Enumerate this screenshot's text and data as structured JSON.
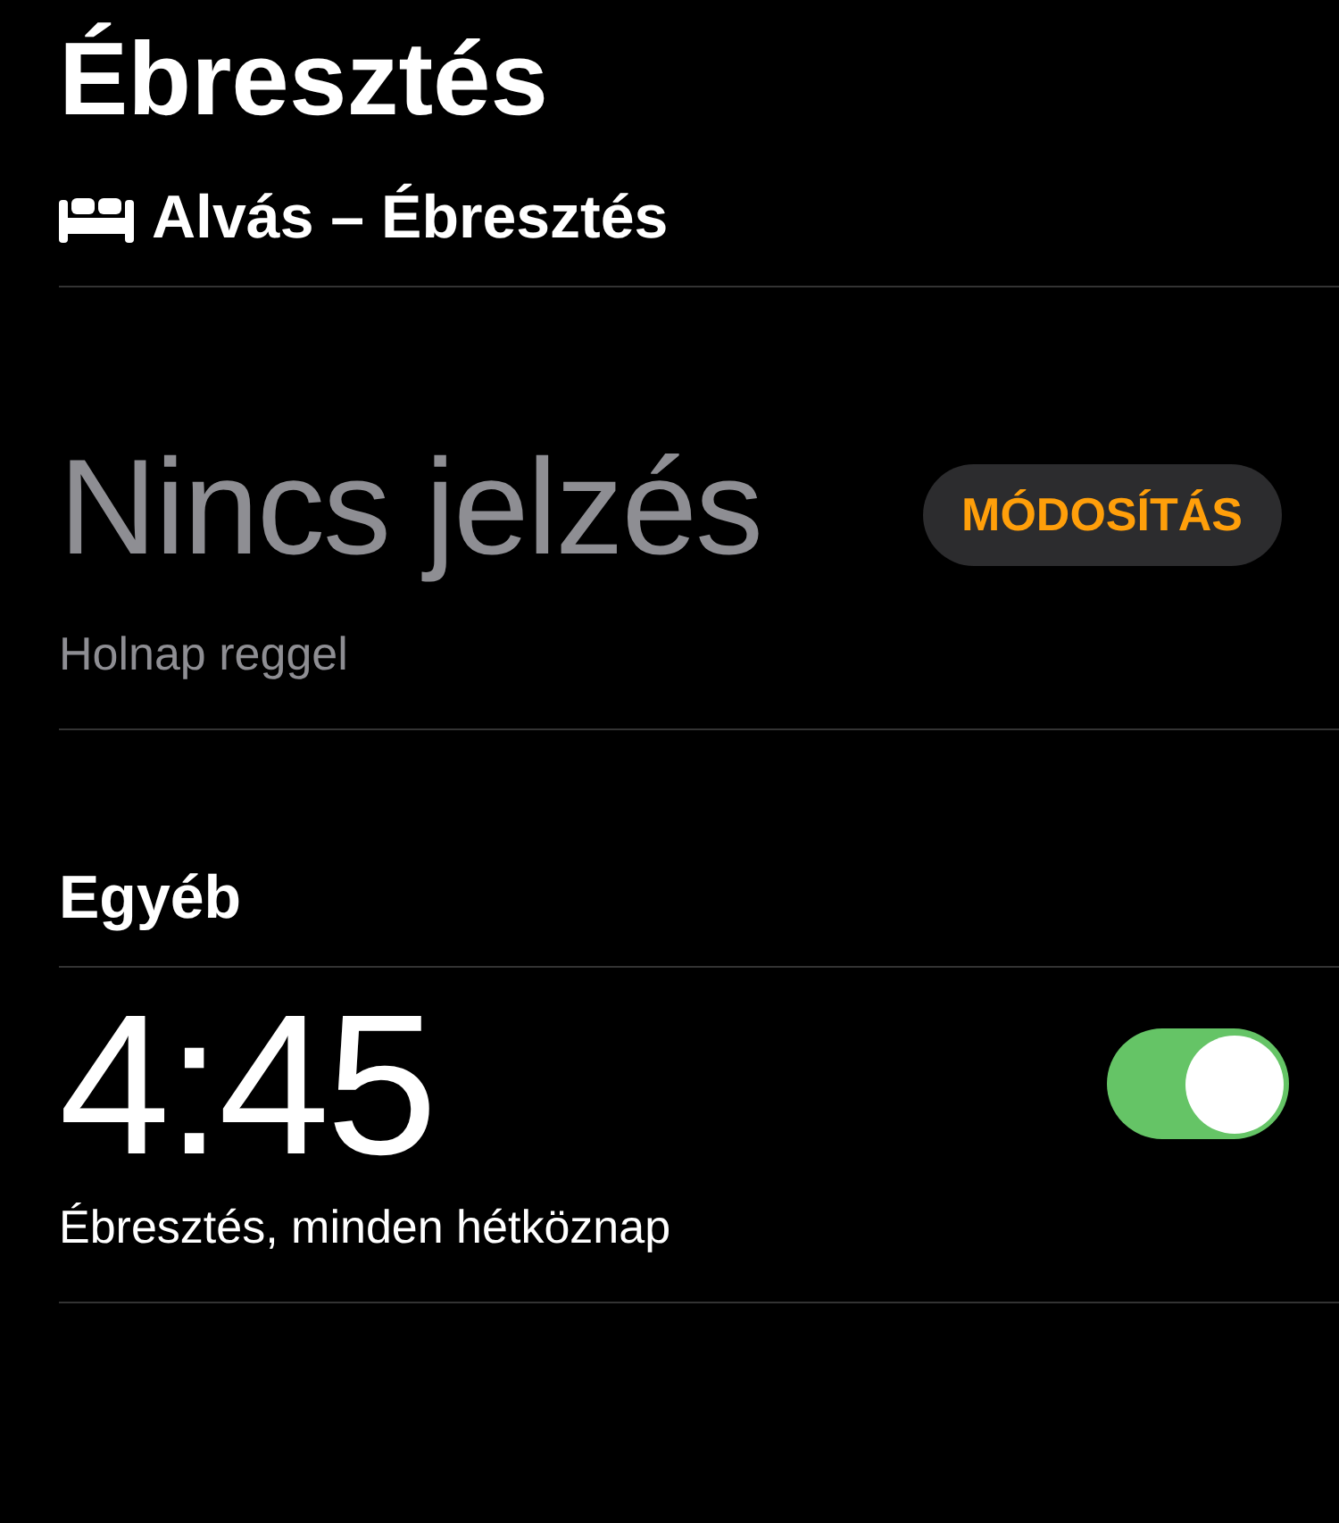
{
  "title": "Ébresztés",
  "sleep_section": {
    "label": "Alvás – Ébresztés"
  },
  "sleep_alarm": {
    "status": "Nincs jelzés",
    "button": "MÓDOSÍTÁS",
    "subtitle": "Holnap reggel"
  },
  "other_section": {
    "label": "Egyéb"
  },
  "alarms": [
    {
      "time": "4:45",
      "label": "Ébresztés, minden hétköznap",
      "on": true
    }
  ]
}
